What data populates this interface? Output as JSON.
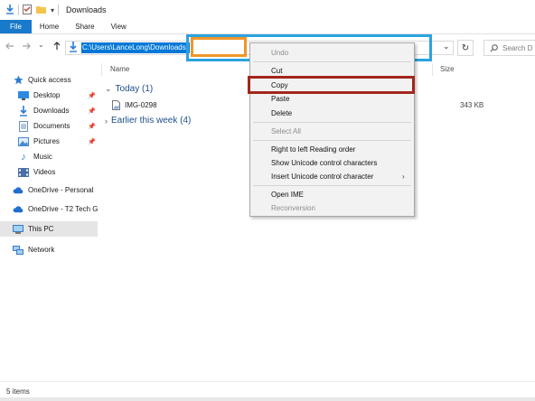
{
  "window": {
    "title": "Downloads"
  },
  "ribbon": {
    "tabs": [
      "File",
      "Home",
      "Share",
      "View"
    ]
  },
  "navbar": {
    "back_icon": "arrow-left-icon",
    "forward_icon": "arrow-right-icon",
    "recent_icon": "chevron-down-icon",
    "up_icon": "arrow-up-icon",
    "address_value": "C:\\Users\\LanceLong\\Downloads",
    "search_placeholder": "Search D"
  },
  "sidebar": {
    "items": [
      {
        "label": "Quick access",
        "icon": "star-icon",
        "pinned": false
      },
      {
        "label": "Desktop",
        "icon": "desktop-icon",
        "pinned": true
      },
      {
        "label": "Downloads",
        "icon": "download-icon",
        "pinned": true
      },
      {
        "label": "Documents",
        "icon": "documents-icon",
        "pinned": true
      },
      {
        "label": "Pictures",
        "icon": "pictures-icon",
        "pinned": true
      },
      {
        "label": "Music",
        "icon": "music-icon",
        "pinned": false
      },
      {
        "label": "Videos",
        "icon": "videos-icon",
        "pinned": false
      },
      {
        "label": "OneDrive - Personal",
        "icon": "cloud-icon",
        "pinned": false
      },
      {
        "label": "OneDrive - T2 Tech G",
        "icon": "cloud-icon",
        "pinned": false
      },
      {
        "label": "This PC",
        "icon": "computer-icon",
        "pinned": false
      },
      {
        "label": "Network",
        "icon": "network-icon",
        "pinned": false
      }
    ]
  },
  "content": {
    "columns": {
      "name": "Name",
      "size": "Size"
    },
    "groups": [
      {
        "label": "Today (1)",
        "expanded": true
      },
      {
        "label": "Earlier this week (4)",
        "expanded": false
      }
    ],
    "files": [
      {
        "name": "IMG-0298",
        "size": "343 KB",
        "icon": "image-file-icon"
      }
    ]
  },
  "context_menu": {
    "items": [
      {
        "label": "Undo",
        "enabled": false
      },
      {
        "label": "Cut",
        "enabled": true
      },
      {
        "label": "Copy",
        "enabled": true
      },
      {
        "label": "Paste",
        "enabled": true
      },
      {
        "label": "Delete",
        "enabled": true
      },
      {
        "label": "Select All",
        "enabled": false
      },
      {
        "label": "Right to left Reading order",
        "enabled": true
      },
      {
        "label": "Show Unicode control characters",
        "enabled": true
      },
      {
        "label": "Insert Unicode control character",
        "enabled": true,
        "submenu": true
      },
      {
        "label": "Open IME",
        "enabled": true
      },
      {
        "label": "Reconversion",
        "enabled": false
      }
    ]
  },
  "status": {
    "item_count": "5 items"
  },
  "colors": {
    "accent": "#0078d7",
    "file_tab": "#1979ca",
    "highlight_blue": "#2aa3e0",
    "highlight_orange": "#f0962a",
    "highlight_red": "#a3261c"
  }
}
